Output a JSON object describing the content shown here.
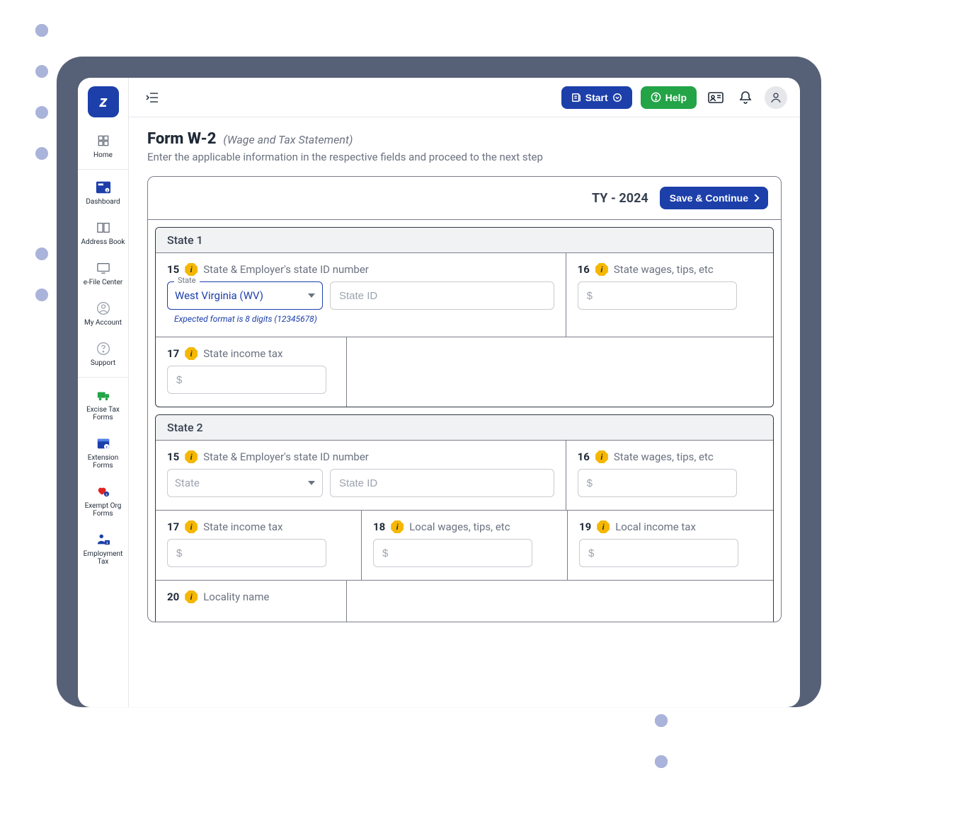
{
  "topbar": {
    "start_label": "Start",
    "help_label": "Help"
  },
  "sidebar": {
    "items": [
      {
        "label": "Home"
      },
      {
        "label": "Dashboard"
      },
      {
        "label": "Address Book"
      },
      {
        "label": "e-File Center"
      },
      {
        "label": "My Account"
      },
      {
        "label": "Support"
      },
      {
        "label": "Excise Tax Forms"
      },
      {
        "label": "Extension Forms"
      },
      {
        "label": "Exempt Org Forms"
      },
      {
        "label": "Employment Tax"
      }
    ]
  },
  "page": {
    "title": "Form W-2",
    "subtitle": "(Wage and Tax Statement)",
    "description": "Enter the applicable information in the respective fields and proceed to the next step"
  },
  "form": {
    "tax_year_label": "TY - 2024",
    "save_label": "Save & Continue",
    "state1": {
      "header": "State 1",
      "f15_num": "15",
      "f15_label": "State & Employer's state ID number",
      "state_floating": "State",
      "state_selected": "West Virginia (WV)",
      "state_id_placeholder": "State ID",
      "state_hint": "Expected format is 8 digits (12345678)",
      "f16_num": "16",
      "f16_label": "State wages, tips, etc",
      "f17_num": "17",
      "f17_label": "State income tax",
      "money_placeholder": "$"
    },
    "state2": {
      "header": "State 2",
      "f15_num": "15",
      "f15_label": "State & Employer's state ID number",
      "state_placeholder": "State",
      "state_id_placeholder": "State ID",
      "f16_num": "16",
      "f16_label": "State wages, tips, etc",
      "f17_num": "17",
      "f17_label": "State income tax",
      "f18_num": "18",
      "f18_label": "Local wages, tips, etc",
      "f19_num": "19",
      "f19_label": "Local income tax",
      "f20_num": "20",
      "f20_label": "Locality name",
      "money_placeholder": "$"
    }
  }
}
